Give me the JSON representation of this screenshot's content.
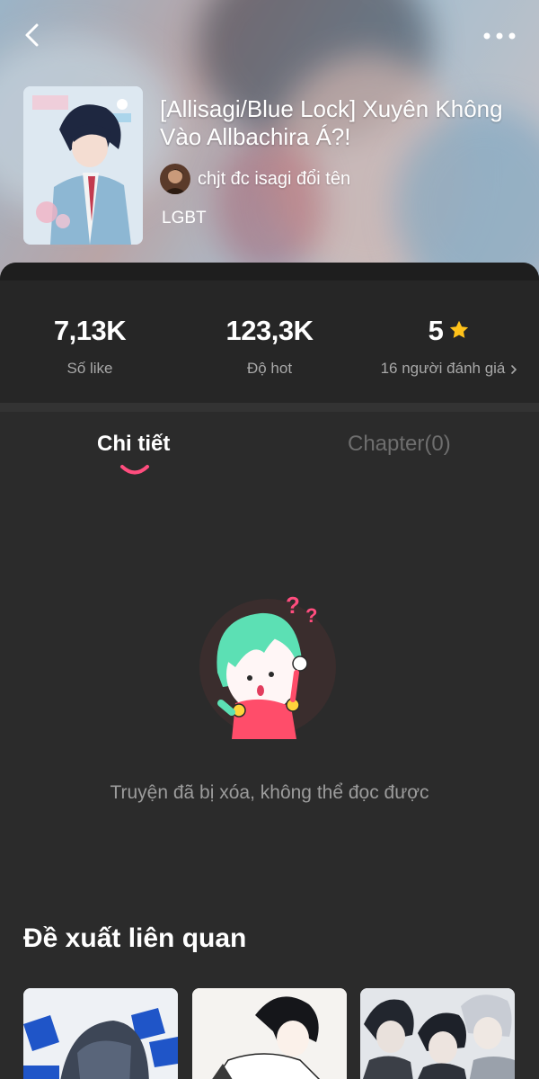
{
  "header": {
    "title": "[Allisagi/Blue Lock] Xuyên Không Vào Allbachira Á?!",
    "author": "chjt đc isagi đổi tên",
    "tag": "LGBT"
  },
  "stats": [
    {
      "value": "7,13K",
      "label": "Số like"
    },
    {
      "value": "123,3K",
      "label": "Độ hot"
    },
    {
      "value": "5",
      "label": "16 người đánh giá"
    }
  ],
  "tabs": [
    {
      "label": "Chi tiết",
      "active": true
    },
    {
      "label": "Chapter(0)",
      "active": false
    }
  ],
  "empty_state": {
    "message": "Truyện đã bị xóa, không thể đọc được"
  },
  "related": {
    "title": "Đề xuất liên quan"
  },
  "colors": {
    "accent_pink": "#ff4d7e",
    "star_yellow": "#ffc21a",
    "sheet_bg": "#2b2b2b"
  },
  "icons": {
    "back": "chevron-left-icon",
    "more": "more-horizontal-icon",
    "star": "star-icon",
    "rating_chevron": "chevron-right-icon"
  }
}
